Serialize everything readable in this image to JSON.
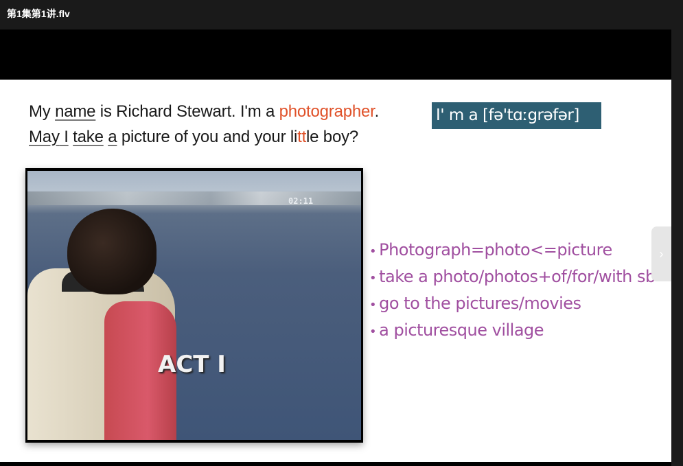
{
  "window": {
    "title": "第1集第1讲.flv"
  },
  "slide": {
    "line1": {
      "pre": "My ",
      "name": "name",
      "mid": " is Richard Stewart. I'm a ",
      "highlight": "photographer",
      "post": "."
    },
    "line2": {
      "may": "May",
      "i": " I",
      "sp1": " ",
      "take": "take",
      "sp2": " ",
      "a": "a",
      "mid": " picture of you and your li",
      "tt": "tt",
      "post": "le boy?"
    },
    "phonetic": "I' m a [fə'tɑːgrəfər]",
    "video_frame": {
      "timestamp": "02:11",
      "caption": "ACT I"
    },
    "notes": [
      "Photograph=photo<=picture",
      "take a photo/photos+of/for/with sb",
      "go to the pictures/movies",
      "a picturesque village"
    ]
  },
  "colors": {
    "highlight": "#e0522a",
    "note": "#a04fa0",
    "phonetic_bg": "#2e5f73"
  },
  "icons": {
    "next": "chevron-right-icon"
  }
}
